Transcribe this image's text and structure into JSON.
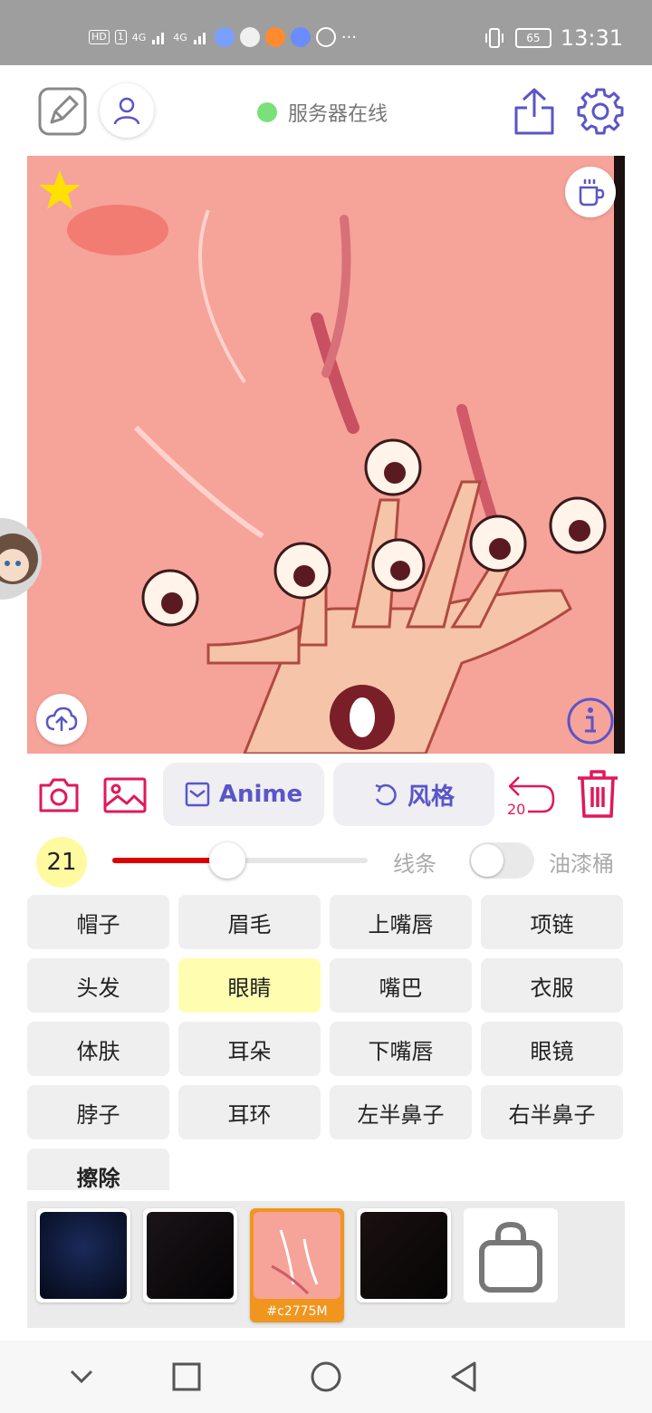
{
  "status_bar": {
    "hd_label": "HD",
    "sim_label": "1",
    "net1": "4G",
    "net2": "4G",
    "more": "···",
    "battery": "65",
    "time": "13:31"
  },
  "header": {
    "server_status": "服务器在线",
    "status_color": "#7ae07a",
    "icons": [
      "edit-icon",
      "user-icon",
      "share-icon",
      "settings-icon"
    ]
  },
  "canvas": {
    "icons": [
      "star-icon",
      "coffee-cup-icon",
      "upload-cloud-icon",
      "info-icon"
    ]
  },
  "toolbar": {
    "anime_label": "Anime",
    "style_label": "风格",
    "undo_count": "20",
    "accent_color": "#e0185c",
    "pill_text_color": "#5a55c8"
  },
  "brush": {
    "size": "21",
    "slider_level": 0.45,
    "line_label": "线条",
    "bucket_label": "油漆桶",
    "bucket_enabled": false
  },
  "parts": {
    "items": [
      "帽子",
      "眉毛",
      "上嘴唇",
      "项链",
      "头发",
      "眼睛",
      "嘴巴",
      "衣服",
      "体肤",
      "耳朵",
      "下嘴唇",
      "眼镜",
      "脖子",
      "耳环",
      "左半鼻子",
      "右半鼻子",
      "擦除"
    ],
    "selected": "眼睛"
  },
  "layers": {
    "selected_label": "#c2775M",
    "icons": [
      "shopping-bag-icon"
    ]
  },
  "nav": {
    "icons": [
      "collapse-icon",
      "recent-apps-icon",
      "home-icon",
      "back-icon"
    ]
  }
}
